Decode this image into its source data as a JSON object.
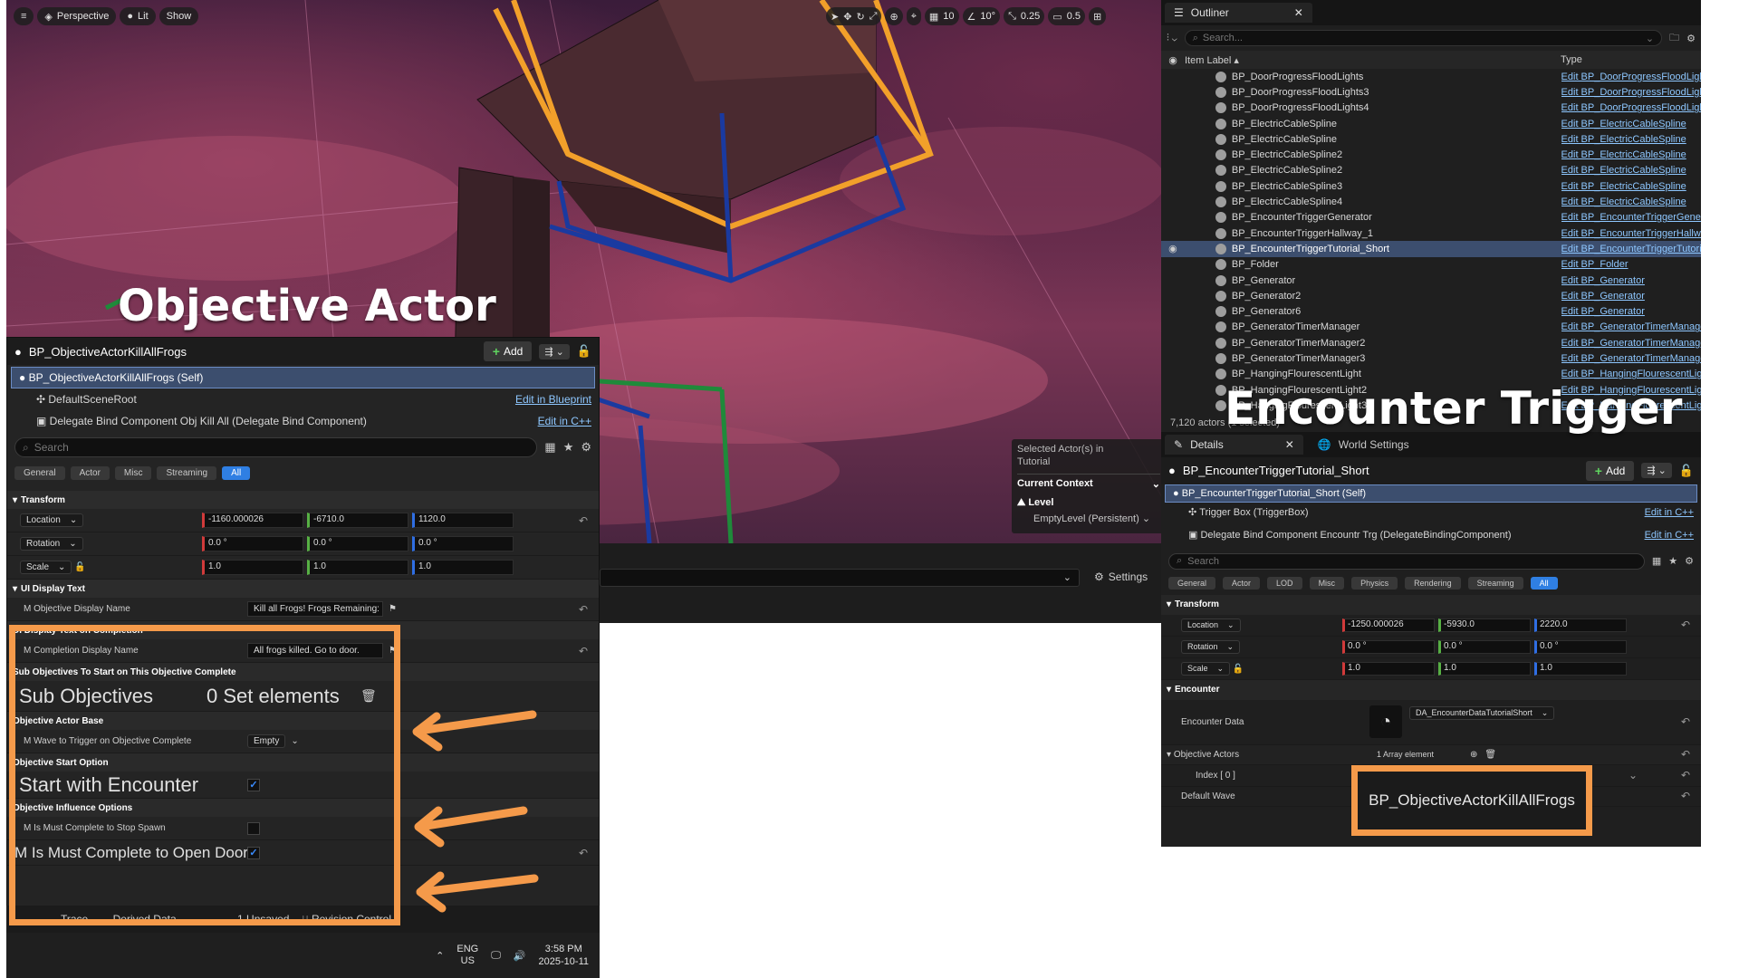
{
  "viewport": {
    "menu_icon": "hamburger-icon",
    "perspective_label": "Perspective",
    "lit_label": "Lit",
    "show_label": "Show",
    "grid_snap": "10",
    "rot_snap": "10°",
    "scale_snap": "0.25",
    "cam_speed": "0.5",
    "selected_actors_line1": "Selected Actor(s) in",
    "selected_actors_line2": "Tutorial",
    "current_context": "Current Context",
    "level_label": "Level",
    "level_value": "EmptyLevel (Persistent)",
    "settings_label": "Settings"
  },
  "overlays": {
    "objective_actor": "Objective Actor",
    "encounter_trigger": "Encounter Trigger",
    "sub_objectives": "Sub Objectives",
    "zero_set": "0 Set elements",
    "start_with_encounter": "Start with Encounter",
    "must_complete_open_door": "M Is Must Complete to Open Door",
    "objective_actor_callout": "BP_ObjectiveActorKillAllFrogs"
  },
  "left_details": {
    "title": "BP_ObjectiveActorKillAllFrogs",
    "add_label": "Add",
    "components": [
      {
        "name": "BP_ObjectiveActorKillAllFrogs (Self)",
        "edit": ""
      },
      {
        "name": "DefaultSceneRoot",
        "edit": "Edit in Blueprint"
      },
      {
        "name": "Delegate Bind Component Obj Kill All (Delegate Bind Component)",
        "edit": "Edit in C++"
      }
    ],
    "search_placeholder": "Search",
    "tabs": [
      "General",
      "Actor",
      "Misc",
      "Streaming",
      "All"
    ],
    "transform_label": "Transform",
    "location_label": "Location",
    "rotation_label": "Rotation",
    "scale_label": "Scale",
    "location": [
      "-1160.000026",
      "-6710.0",
      "1120.0"
    ],
    "rotation": [
      "0.0 °",
      "0.0 °",
      "0.0 °"
    ],
    "scale": [
      "1.0",
      "1.0",
      "1.0"
    ],
    "ui_display_text": "UI Display Text",
    "m_objective_display_name": "M Objective Display Name",
    "objective_display_value": "Kill all Frogs! Frogs Remaining:",
    "ui_display_text_completion": "UI Display Text on Completion",
    "m_completion_display_name": "M Completion Display Name",
    "completion_display_value": "All frogs killed. Go to door.",
    "sub_objectives_cat": "Sub Objectives To Start on This Objective Complete",
    "objective_actor_base": "Objective Actor Base",
    "m_wave_trigger": "M Wave to Trigger on Objective Complete",
    "wave_value": "Empty",
    "objective_start_option": "Objective Start Option",
    "objective_influence": "Objective Influence Options",
    "m_must_complete_stop_spawn": "M Is Must Complete to Stop Spawn"
  },
  "status_bar": {
    "trace": "Trace",
    "derived_data": "Derived Data",
    "unsaved": "1 Unsaved",
    "revision_control": "Revision Control"
  },
  "taskbar": {
    "lang1": "ENG",
    "lang2": "US",
    "time": "3:58 PM",
    "date": "2025-10-11"
  },
  "outliner": {
    "tab_label": "Outliner",
    "search_placeholder": "Search...",
    "col_item_label": "Item Label",
    "col_type": "Type",
    "rows": [
      {
        "name": "BP_DoorProgressFloodLights",
        "type": "Edit BP_DoorProgressFloodLights",
        "selected": false
      },
      {
        "name": "BP_DoorProgressFloodLights3",
        "type": "Edit BP_DoorProgressFloodLights",
        "selected": false
      },
      {
        "name": "BP_DoorProgressFloodLights4",
        "type": "Edit BP_DoorProgressFloodLights",
        "selected": false
      },
      {
        "name": "BP_ElectricCableSpline",
        "type": "Edit BP_ElectricCableSpline",
        "selected": false
      },
      {
        "name": "BP_ElectricCableSpline",
        "type": "Edit BP_ElectricCableSpline",
        "selected": false
      },
      {
        "name": "BP_ElectricCableSpline2",
        "type": "Edit BP_ElectricCableSpline",
        "selected": false
      },
      {
        "name": "BP_ElectricCableSpline2",
        "type": "Edit BP_ElectricCableSpline",
        "selected": false
      },
      {
        "name": "BP_ElectricCableSpline3",
        "type": "Edit BP_ElectricCableSpline",
        "selected": false
      },
      {
        "name": "BP_ElectricCableSpline4",
        "type": "Edit BP_ElectricCableSpline",
        "selected": false
      },
      {
        "name": "BP_EncounterTriggerGenerator",
        "type": "Edit BP_EncounterTriggerGenerator",
        "selected": false
      },
      {
        "name": "BP_EncounterTriggerHallway_1",
        "type": "Edit BP_EncounterTriggerHallway",
        "selected": false
      },
      {
        "name": "BP_EncounterTriggerTutorial_Short",
        "type": "Edit BP_EncounterTriggerTutorial",
        "selected": true
      },
      {
        "name": "BP_Folder",
        "type": "Edit BP_Folder",
        "selected": false
      },
      {
        "name": "BP_Generator",
        "type": "Edit BP_Generator",
        "selected": false
      },
      {
        "name": "BP_Generator2",
        "type": "Edit BP_Generator",
        "selected": false
      },
      {
        "name": "BP_Generator6",
        "type": "Edit BP_Generator",
        "selected": false
      },
      {
        "name": "BP_GeneratorTimerManager",
        "type": "Edit BP_GeneratorTimerManager",
        "selected": false
      },
      {
        "name": "BP_GeneratorTimerManager2",
        "type": "Edit BP_GeneratorTimerManager",
        "selected": false
      },
      {
        "name": "BP_GeneratorTimerManager3",
        "type": "Edit BP_GeneratorTimerManager",
        "selected": false
      },
      {
        "name": "BP_HangingFlourescentLight",
        "type": "Edit BP_HangingFlourescentLight",
        "selected": false
      },
      {
        "name": "BP_HangingFlourescentLight2",
        "type": "Edit BP_HangingFlourescentLight",
        "selected": false
      },
      {
        "name": "BP_HangingFlourescentLight3",
        "type": "Edit BP_HangingFlourescentLight",
        "selected": false
      }
    ],
    "count": "7,120 actors (1 selected)"
  },
  "right_details": {
    "tab_details": "Details",
    "tab_world": "World Settings",
    "title": "BP_EncounterTriggerTutorial_Short",
    "add_label": "Add",
    "components": [
      {
        "name": "BP_EncounterTriggerTutorial_Short (Self)",
        "edit": ""
      },
      {
        "name": "Trigger Box (TriggerBox)",
        "edit": "Edit in C++"
      },
      {
        "name": "Delegate Bind Component Encountr Trg (DelegateBindingComponent)",
        "edit": "Edit in C++"
      }
    ],
    "search_placeholder": "Search",
    "tabs": [
      "General",
      "Actor",
      "LOD",
      "Misc",
      "Physics",
      "Rendering",
      "Streaming",
      "All"
    ],
    "transform_label": "Transform",
    "location_label": "Location",
    "rotation_label": "Rotation",
    "scale_label": "Scale",
    "location": [
      "-1250.000026",
      "-5930.0",
      "2220.0"
    ],
    "rotation": [
      "0.0 °",
      "0.0 °",
      "0.0 °"
    ],
    "scale": [
      "1.0",
      "1.0",
      "1.0"
    ],
    "encounter_cat": "Encounter",
    "encounter_data": "Encounter Data",
    "encounter_data_value": "DA_EncounterDataTutorialShort",
    "objective_actors": "Objective Actors",
    "array_element": "1 Array element",
    "index0": "Index [ 0 ]",
    "default_wave": "Default Wave"
  }
}
